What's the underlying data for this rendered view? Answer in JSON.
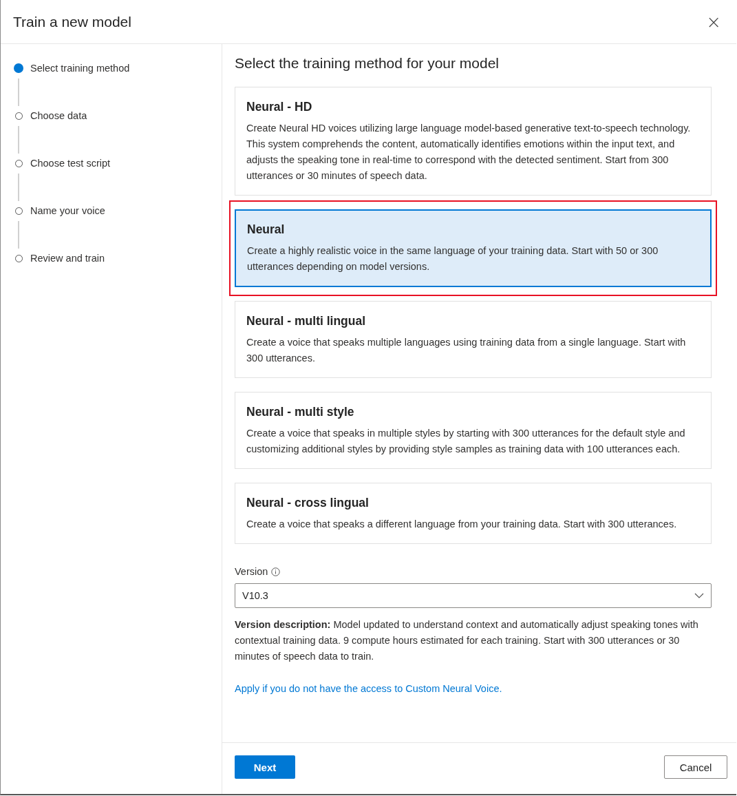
{
  "dialog": {
    "title": "Train a new model",
    "close": "×"
  },
  "steps": [
    {
      "label": "Select training method",
      "selected": true
    },
    {
      "label": "Choose data",
      "selected": false
    },
    {
      "label": "Choose test script",
      "selected": false
    },
    {
      "label": "Name your voice",
      "selected": false
    },
    {
      "label": "Review and train",
      "selected": false
    }
  ],
  "heading": "Select the training method for your model",
  "methods": [
    {
      "title": "Neural - HD",
      "description": "Create Neural HD voices utilizing large language model-based generative text-to-speech technology. This system comprehends the content, automatically identifies emotions within the input text, and adjusts the speaking tone in real-time to correspond with the detected sentiment. Start from 300 utterances or 30 minutes of speech data.",
      "selected": false,
      "annotated": false
    },
    {
      "title": "Neural",
      "description": "Create a highly realistic voice in the same language of your training data. Start with 50 or 300 utterances depending on model versions.",
      "selected": true,
      "annotated": true
    },
    {
      "title": "Neural - multi lingual",
      "description": "Create a voice that speaks multiple languages using training data from a single language. Start with 300 utterances.",
      "selected": false,
      "annotated": false
    },
    {
      "title": "Neural - multi style",
      "description": "Create a voice that speaks in multiple styles by starting with 300 utterances for the default style and customizing additional styles by providing style samples as training data with 100 utterances each.",
      "selected": false,
      "annotated": false
    },
    {
      "title": "Neural - cross lingual",
      "description": "Create a voice that speaks a different language from your training data. Start with 300 utterances.",
      "selected": false,
      "annotated": false
    }
  ],
  "version": {
    "label": "Version",
    "value": "V10.3",
    "description": "**Version description:** Model updated to understand context and automatically adjust speaking tones with contextual training data. 9 compute hours estimated for each training. Start with 300 utterances or 30 minutes of speech data to train."
  },
  "apply_link": "Apply if you do not have the access to Custom Neural Voice.",
  "buttons": {
    "next": "Next",
    "cancel": "Cancel"
  }
}
